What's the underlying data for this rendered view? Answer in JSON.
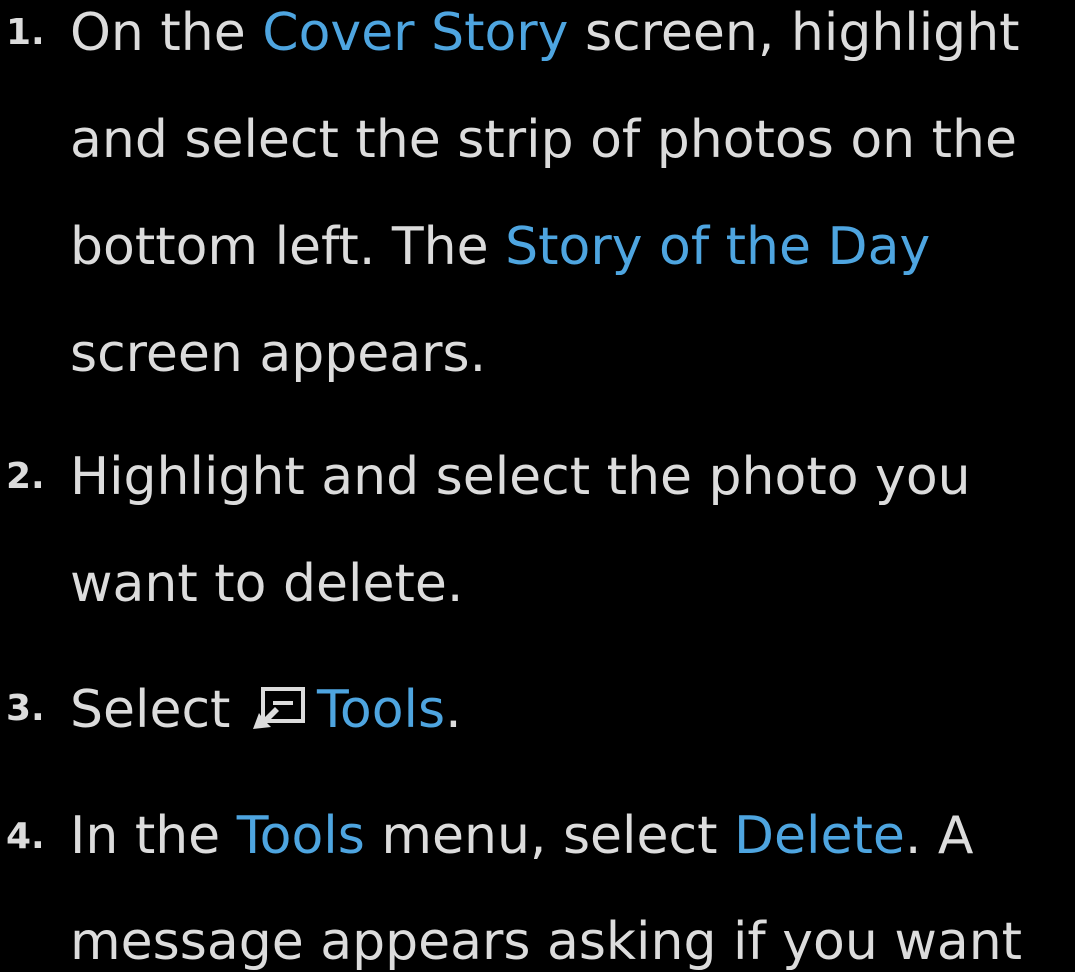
{
  "colors": {
    "text": "#dcdcdc",
    "highlight": "#4ea5e0",
    "background": "#000000"
  },
  "steps": [
    {
      "number": "1.",
      "line1": {
        "a": "On the ",
        "b": "Cover Story",
        "c": " screen, highlight"
      },
      "line2": "and select the strip of photos on the",
      "line3": {
        "a": "bottom left. The ",
        "b": "Story of the Day"
      },
      "line4": "screen appears."
    },
    {
      "number": "2.",
      "line1": "Highlight and select the photo you",
      "line2": "want to delete."
    },
    {
      "number": "3.",
      "line1": {
        "a": "Select ",
        "icon": "tools-icon",
        "b": "Tools",
        "c": "."
      }
    },
    {
      "number": "4.",
      "line1": {
        "a": "In the ",
        "b": "Tools",
        "c": " menu, select ",
        "d": "Delete",
        "e": ". A"
      },
      "line2": "message appears asking if you want"
    }
  ]
}
